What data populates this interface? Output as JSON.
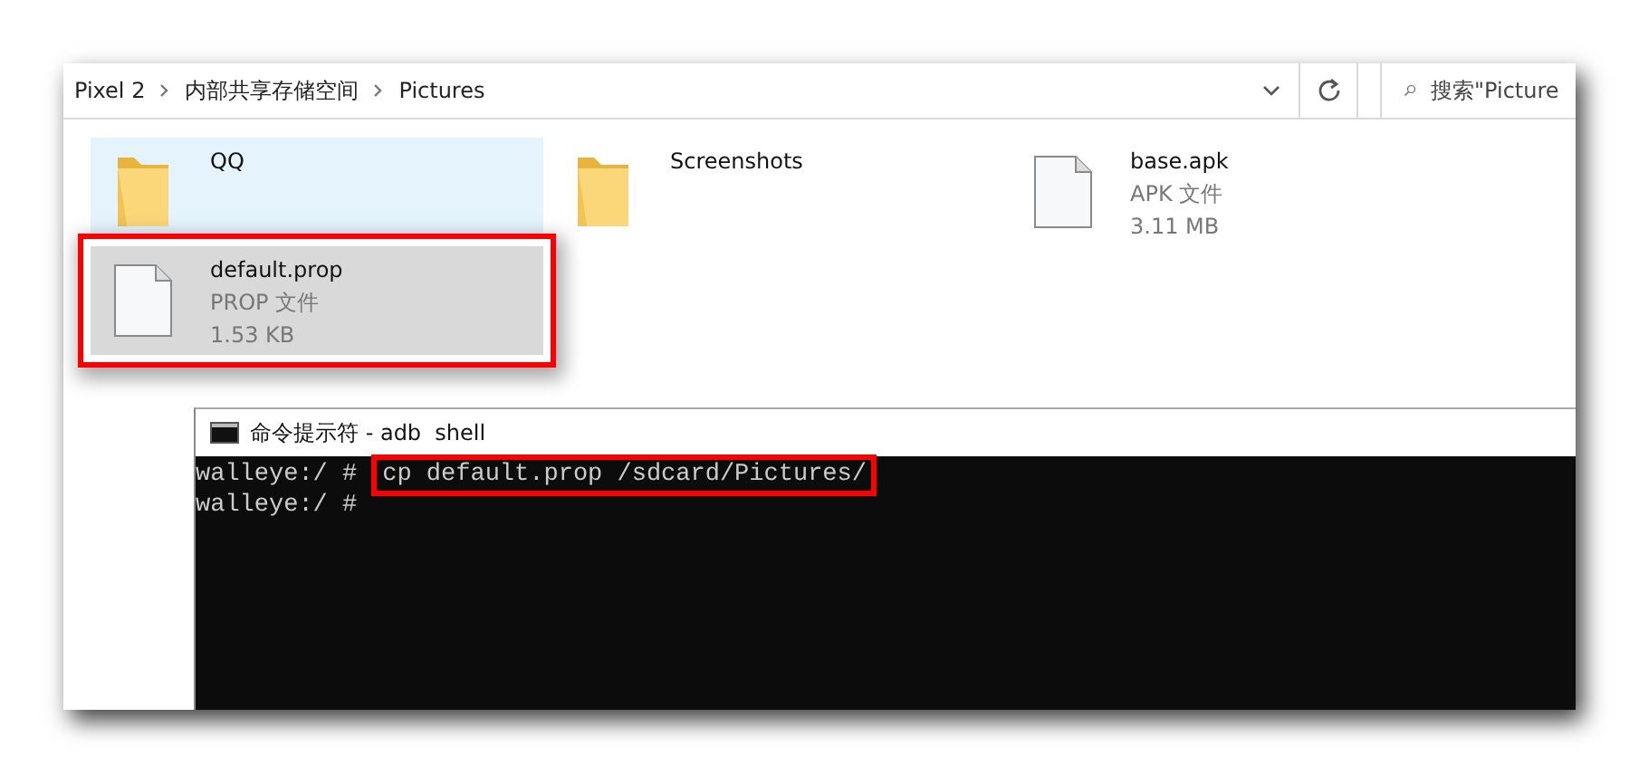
{
  "address_bar": {
    "breadcrumb": [
      {
        "label": "Pixel 2"
      },
      {
        "label": "内部共享存储空间"
      },
      {
        "label": "Pictures"
      }
    ],
    "search": {
      "placeholder": "搜索\"Picture"
    }
  },
  "files": [
    {
      "kind": "folder",
      "name": "QQ",
      "hovered": true,
      "selected": false,
      "highlighted": false
    },
    {
      "kind": "folder",
      "name": "Screenshots",
      "hovered": false,
      "selected": false,
      "highlighted": false
    },
    {
      "kind": "file",
      "name": "base.apk",
      "type": "APK 文件",
      "size": "3.11 MB",
      "hovered": false,
      "selected": false,
      "highlighted": false
    },
    {
      "kind": "file",
      "name": "default.prop",
      "type": "PROP 文件",
      "size": "1.53 KB",
      "hovered": false,
      "selected": true,
      "highlighted": true
    }
  ],
  "console": {
    "title": "命令提示符 - adb  shell",
    "lines": [
      {
        "prompt": "walleye:/ #",
        "command": "cp default.prop /sdcard/Pictures/",
        "highlighted": true
      },
      {
        "prompt": "walleye:/ #"
      }
    ]
  }
}
